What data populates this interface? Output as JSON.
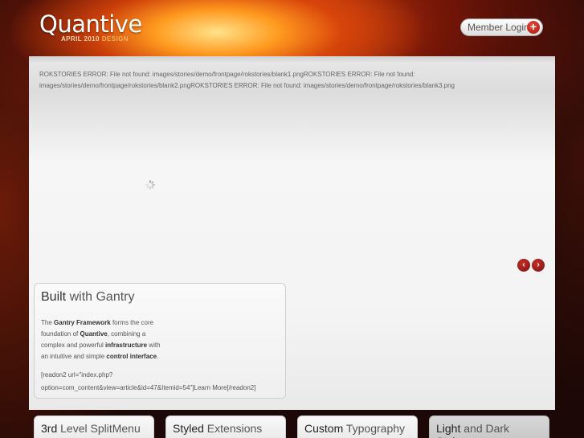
{
  "header": {
    "logo_name": "Quantive",
    "logo_tagline": "APRIL 2010",
    "logo_tagline_2": "DESIGN",
    "login_label": "Member Login",
    "login_icon": "plus-circle-icon"
  },
  "showcase": {
    "error_text": "ROKSTORIES ERROR: File not found: images/stories/demo/frontpage/rokstories/blank1.pngROKSTORIES ERROR: File not found: images/stories/demo/frontpage/rokstories/blank2.pngROKSTORIES ERROR: File not found: images/stories/demo/frontpage/rokstories/blank3.png",
    "prev_label": "‹",
    "next_label": "›"
  },
  "feature": {
    "title_strong": "Built",
    "title_light": "with Gantry",
    "p1_a": "The ",
    "p1_b": "Gantry Framework",
    "p1_c": " forms the core",
    "p2_a": "foundation of ",
    "p2_b": "Quantive",
    "p2_c": ", combining a",
    "p3_a": "complex and powerful ",
    "p3_b": "infrastructure",
    "p3_c": " with",
    "p4_a": "an intuitive and simple ",
    "p4_b": "control interface",
    "p4_c": ".",
    "readon_1": "[readon2 url=\"index.php?",
    "readon_2": "option=com_content&view=article&id=47&Itemid=54\"]Learn More[/readon2]"
  },
  "tabs": [
    {
      "strong": "3rd",
      "light": " Level SplitMenu"
    },
    {
      "strong": "Styled",
      "light": " Extensions"
    },
    {
      "strong": "Custom",
      "light": " Typography"
    },
    {
      "strong": "Light",
      "light": " and Dark Styles"
    }
  ]
}
